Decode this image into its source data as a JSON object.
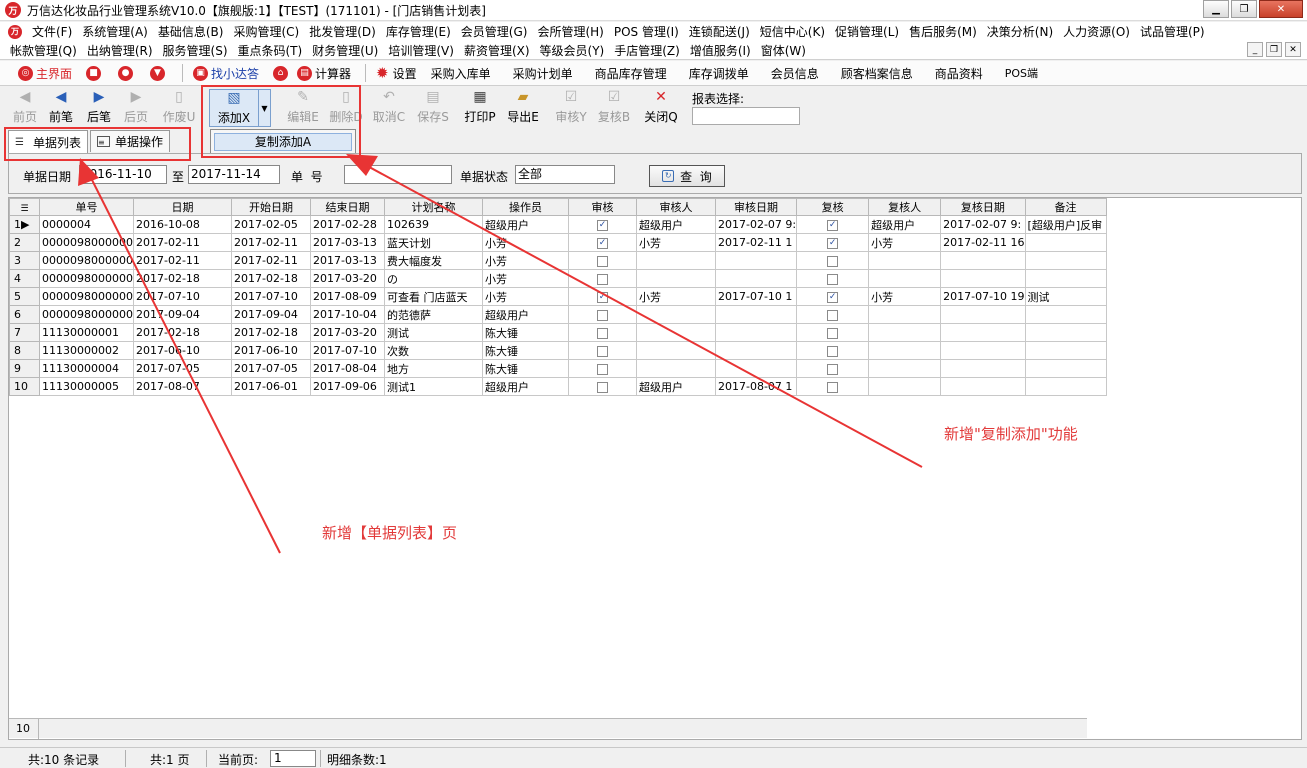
{
  "title": "万信达化妆品行业管理系统V10.0【旗舰版:1】【TEST】(171101) - [门店销售计划表]",
  "menu_row1": [
    "文件(F)",
    "系统管理(A)",
    "基础信息(B)",
    "采购管理(C)",
    "批发管理(D)",
    "库存管理(E)",
    "会员管理(G)",
    "会所管理(H)",
    "POS 管理(I)",
    "连锁配送(J)",
    "短信中心(K)",
    "促销管理(L)",
    "售后服务(M)",
    "决策分析(N)",
    "人力资源(O)",
    "试品管理(P)"
  ],
  "menu_row2": [
    "帐款管理(Q)",
    "出纳管理(R)",
    "服务管理(S)",
    "重点条码(T)",
    "财务管理(U)",
    "培训管理(V)",
    "薪资管理(X)",
    "等级会员(Y)",
    "手店管理(Z)",
    "增值服务(I)",
    "窗体(W)"
  ],
  "quickbar": {
    "home": "主界面",
    "find": "找小达答",
    "calculator": "计算器",
    "settings": "设置",
    "links": [
      "采购入库单",
      "采购计划单",
      "商品库存管理",
      "库存调拨单",
      "会员信息",
      "顾客档案信息",
      "商品资料",
      "POS端"
    ]
  },
  "toolbar": {
    "first": "前页",
    "prev": "前笔",
    "next": "后笔",
    "last": "后页",
    "void": "作废U",
    "add": "添加X",
    "edit": "编辑E",
    "delete": "删除D",
    "cancel": "取消C",
    "save": "保存S",
    "print": "打印P",
    "export": "导出E",
    "audit": "审核Y",
    "reaudit": "复核B",
    "close": "关闭Q",
    "report_label": "报表选择:"
  },
  "dropdown": {
    "copy_add": "复制添加A"
  },
  "tabs": {
    "list": "单据列表",
    "operate": "单据操作"
  },
  "filter": {
    "date_label": "单据日期",
    "date_from": "2016-11-10",
    "to_label": "至",
    "date_to": "2017-11-14",
    "no_label": "单  号",
    "no_value": "",
    "status_label": "单据状态",
    "status_value": "全部",
    "query_button": "查  询"
  },
  "grid": {
    "columns": [
      "单号",
      "日期",
      "开始日期",
      "结束日期",
      "计划名称",
      "操作员",
      "审核",
      "审核人",
      "审核日期",
      "复核",
      "复核人",
      "复核日期",
      "备注"
    ],
    "rows": [
      {
        "rn": "1",
        "no": "0000004",
        "date": "2016-10-08",
        "start": "2017-02-05",
        "end": "2017-02-28",
        "name": "102639",
        "op": "超级用户",
        "audit": true,
        "auditor": "超级用户",
        "audit_date": "2017-02-07 9:",
        "review": true,
        "reviewer": "超级用户",
        "review_date": "2017-02-07 9:",
        "remark": "[超级用户]反审"
      },
      {
        "rn": "2",
        "no": "0000098000000",
        "date": "2017-02-11",
        "start": "2017-02-11",
        "end": "2017-03-13",
        "name": "蓝天计划",
        "op": "小芳",
        "audit": true,
        "auditor": "小芳",
        "audit_date": "2017-02-11 1",
        "review": true,
        "reviewer": "小芳",
        "review_date": "2017-02-11 16",
        "remark": ""
      },
      {
        "rn": "3",
        "no": "0000098000000",
        "date": "2017-02-11",
        "start": "2017-02-11",
        "end": "2017-03-13",
        "name": "费大幅度发",
        "op": "小芳",
        "audit": false,
        "auditor": "",
        "audit_date": "",
        "review": false,
        "reviewer": "",
        "review_date": "",
        "remark": ""
      },
      {
        "rn": "4",
        "no": "0000098000000",
        "date": "2017-02-18",
        "start": "2017-02-18",
        "end": "2017-03-20",
        "name": "の",
        "op": "小芳",
        "audit": false,
        "auditor": "",
        "audit_date": "",
        "review": false,
        "reviewer": "",
        "review_date": "",
        "remark": ""
      },
      {
        "rn": "5",
        "no": "0000098000000",
        "date": "2017-07-10",
        "start": "2017-07-10",
        "end": "2017-08-09",
        "name": "可查看 门店蓝天",
        "op": "小芳",
        "audit": true,
        "auditor": "小芳",
        "audit_date": "2017-07-10 1",
        "review": true,
        "reviewer": "小芳",
        "review_date": "2017-07-10 19",
        "remark": "测试"
      },
      {
        "rn": "6",
        "no": "0000098000000",
        "date": "2017-09-04",
        "start": "2017-09-04",
        "end": "2017-10-04",
        "name": "的范德萨",
        "op": "超级用户",
        "audit": false,
        "auditor": "",
        "audit_date": "",
        "review": false,
        "reviewer": "",
        "review_date": "",
        "remark": ""
      },
      {
        "rn": "7",
        "no": "11130000001",
        "date": "2017-02-18",
        "start": "2017-02-18",
        "end": "2017-03-20",
        "name": "测试",
        "op": "陈大锤",
        "audit": false,
        "auditor": "",
        "audit_date": "",
        "review": false,
        "reviewer": "",
        "review_date": "",
        "remark": ""
      },
      {
        "rn": "8",
        "no": "11130000002",
        "date": "2017-06-10",
        "start": "2017-06-10",
        "end": "2017-07-10",
        "name": "次数",
        "op": "陈大锤",
        "audit": false,
        "auditor": "",
        "audit_date": "",
        "review": false,
        "reviewer": "",
        "review_date": "",
        "remark": ""
      },
      {
        "rn": "9",
        "no": "11130000004",
        "date": "2017-07-05",
        "start": "2017-07-05",
        "end": "2017-08-04",
        "name": "地方",
        "op": "陈大锤",
        "audit": false,
        "auditor": "",
        "audit_date": "",
        "review": false,
        "reviewer": "",
        "review_date": "",
        "remark": ""
      },
      {
        "rn": "10",
        "no": "11130000005",
        "date": "2017-08-07",
        "start": "2017-06-01",
        "end": "2017-09-06",
        "name": "测试1",
        "op": "超级用户",
        "audit": false,
        "auditor": "超级用户",
        "audit_date": "2017-08-07 1",
        "review": false,
        "reviewer": "",
        "review_date": "",
        "remark": ""
      }
    ],
    "footer_count": "10"
  },
  "status": {
    "total_records": "共:10 条记录",
    "total_pages": "共:1 页",
    "current_page_label": "当前页:",
    "current_page": "1",
    "detail_count": "明细条数:1"
  },
  "annotations": {
    "copy_add_note": "新增\"复制添加\"功能",
    "list_page_note": "新增【单据列表】页"
  },
  "colors": {
    "annotation": "#e83434",
    "brand": "#d8262b"
  }
}
